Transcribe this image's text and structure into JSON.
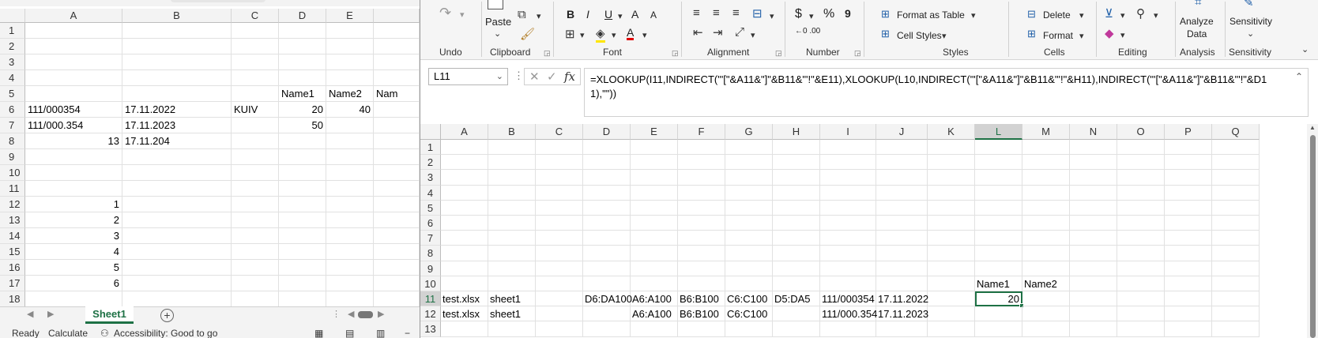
{
  "left": {
    "columns": [
      "A",
      "B",
      "C",
      "D",
      "E"
    ],
    "rows": [
      "1",
      "2",
      "3",
      "4",
      "5",
      "6",
      "7",
      "8",
      "9",
      "10",
      "11",
      "12",
      "13",
      "14",
      "15",
      "16",
      "17",
      "18"
    ],
    "cells": {
      "D5": "Name1",
      "E5": "Name2",
      "F5": "Nam",
      "A6": "111/000354",
      "B6": "17.11.2022",
      "C6": "KUIV",
      "D6": "20",
      "E6": "40",
      "A7": "111/000.354",
      "B7": "17.11.2023",
      "D7": "50",
      "A8": "13",
      "B8": "17.11.204",
      "A12": "1",
      "A13": "2",
      "A14": "3",
      "A15": "4",
      "A16": "5",
      "A17": "6"
    },
    "sheet_tab": "Sheet1",
    "add_sheet": "+",
    "status": {
      "ready": "Ready",
      "calculate": "Calculate",
      "accessibility": "Accessibility: Good to go"
    }
  },
  "right": {
    "ribbon": {
      "groups": {
        "undo": "Undo",
        "clipboard": "Clipboard",
        "font": "Font",
        "alignment": "Alignment",
        "number": "Number",
        "styles": "Styles",
        "cells": "Cells",
        "editing": "Editing",
        "analysis": "Analysis",
        "sensitivity": "Sensitivity"
      },
      "paste": "Paste",
      "format_as_table": "Format as Table",
      "cell_styles": "Cell Styles",
      "delete": "Delete",
      "format": "Format",
      "analyze_data_1": "Analyze",
      "analyze_data_2": "Data",
      "sensitivity_btn": "Sensitivity",
      "bold": "B",
      "italic": "I",
      "underline": "U",
      "grow_font": "A",
      "shrink_font": "A",
      "currency": "$",
      "percent": "%",
      "comma": "9",
      "inc_decimal": "←0 .00",
      "dec_decimal": ".00 →0"
    },
    "name_box": "L11",
    "formula": "=XLOOKUP(I11,INDIRECT(\"'[\"&A11&\"]\"&B11&\"'!\"&E11),XLOOKUP(L10,INDIRECT(\"'[\"&A11&\"]\"&B11&\"'!\"&H11),INDIRECT(\"'[\"&A11&\"]\"&B11&\"'!\"&D11),\"\"))",
    "columns": [
      "A",
      "B",
      "C",
      "D",
      "E",
      "F",
      "G",
      "H",
      "I",
      "J",
      "K",
      "L",
      "M",
      "N",
      "O",
      "P",
      "Q"
    ],
    "rows": [
      "1",
      "2",
      "3",
      "4",
      "5",
      "6",
      "7",
      "8",
      "9",
      "10",
      "11",
      "12",
      "13"
    ],
    "cells": {
      "L10": "Name1",
      "M10": "Name2",
      "A11": "test.xlsx",
      "B11": "sheet1",
      "D11": "D6:DA100",
      "E11": "A6:A100",
      "F11": "B6:B100",
      "G11": "C6:C100",
      "H11": "D5:DA5",
      "I11": "111/000354",
      "J11": "17.11.2022",
      "L11": "20",
      "A12": "test.xlsx",
      "B12": "sheet1",
      "E12": "A6:A100",
      "F12": "B6:B100",
      "G12": "C6:C100",
      "I12": "111/000.354",
      "J12": "17.11.2023"
    },
    "active_cell": "L11"
  }
}
